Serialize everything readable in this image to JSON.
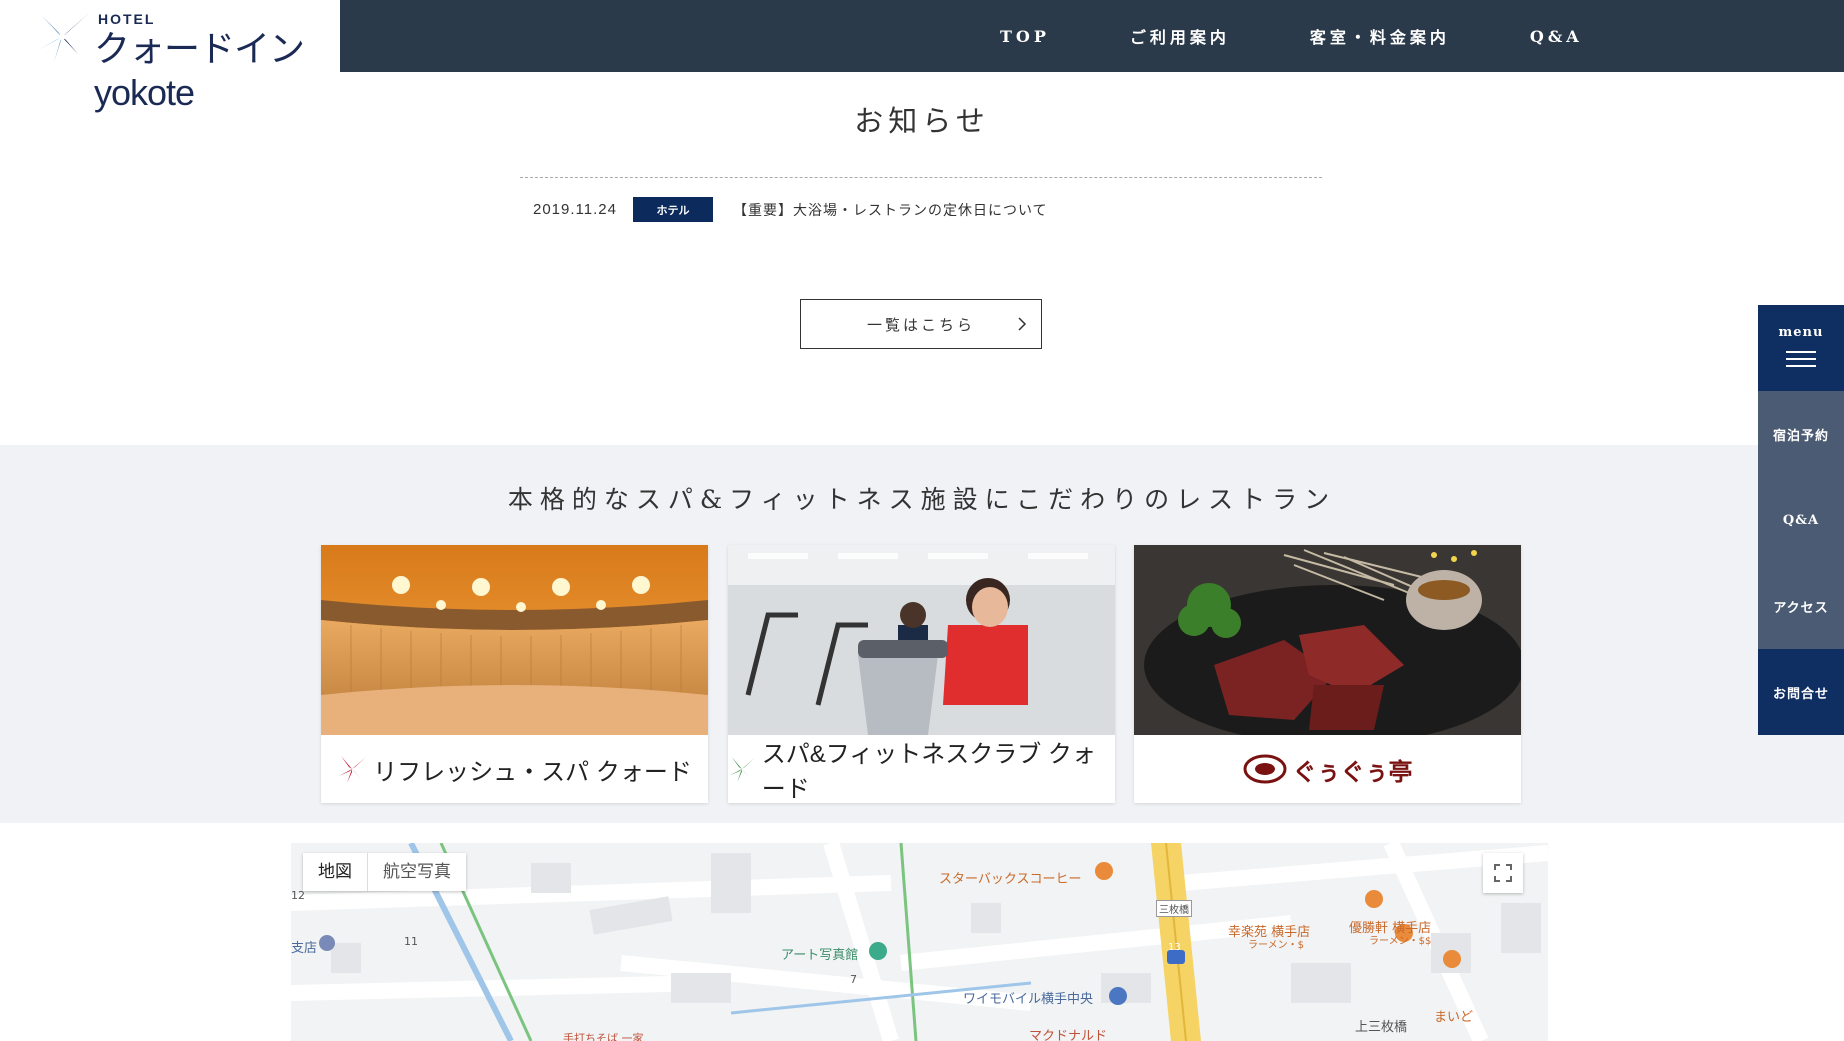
{
  "header": {
    "logo_hotel": "HOTEL",
    "logo_name": "クォードイン yokote",
    "nav": [
      "TOP",
      "ご利用案内",
      "客室・料金案内",
      "Q&A"
    ]
  },
  "notices": {
    "title": "お知らせ",
    "items": [
      {
        "date": "2019.11.24",
        "category": "ホテル",
        "text": "【重要】大浴場・レストランの定休日について"
      }
    ],
    "list_button": "一覧はこちら"
  },
  "facilities": {
    "title": "本格的なスパ&フィットネス施設にこだわりのレストラン",
    "cards": [
      {
        "brand": "リフレッシュ・スパ クォード",
        "accent": "#c4102a"
      },
      {
        "brand": "スパ&フィットネスクラブ クォード",
        "accent": "#2d8a3a"
      },
      {
        "brand": "ぐぅぐぅ亭",
        "accent": "#7a1212"
      }
    ]
  },
  "map": {
    "type_map": "地図",
    "type_satellite": "航空写真",
    "labels": {
      "starbucks": "スターバックスコーヒー",
      "sanmaibashi": "三枚橋",
      "koorakuen": "幸楽苑 横手店",
      "koorakuen_sub": "ラーメン・$",
      "yushoken": "優勝軒 横手店",
      "yushoken_sub": "ラーメン・$$",
      "art_photo": "アート写真館",
      "ymobile": "ワイモバイル横手中央",
      "mcdonalds": "マクドナルド",
      "kamisanmai": "上三枚橋",
      "maido": "まいど",
      "teuchi": "手打ちそば 一家",
      "branch": "支店",
      "num_12": "12",
      "num_11": "11",
      "num_7": "7",
      "route_13": "13"
    }
  },
  "side_menu": {
    "menu": "menu",
    "items": [
      "宿泊予約",
      "Q&A",
      "アクセス",
      "お問合せ"
    ]
  }
}
